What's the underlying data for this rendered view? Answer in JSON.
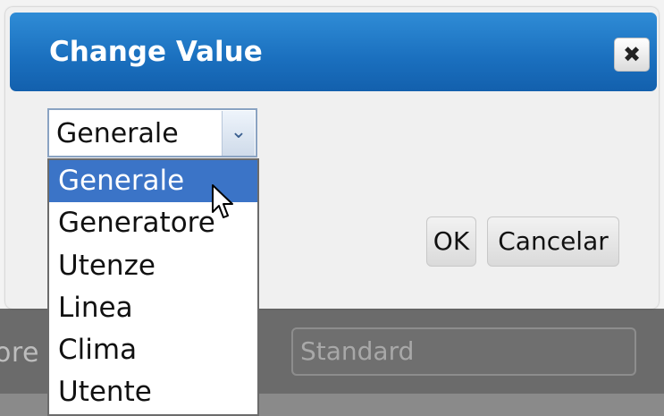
{
  "background": {
    "field_label_partial": "ore",
    "field_value": "Standard"
  },
  "dialog": {
    "title": "Change Value",
    "close_glyph": "✖",
    "select": {
      "value": "Generale",
      "arrow_glyph": "⌄"
    },
    "options": [
      "Generale",
      "Generatore",
      "Utenze",
      "Linea",
      "Clima",
      "Utente"
    ],
    "highlighted_option": "Generale",
    "ok_label": "OK",
    "cancel_label": "Cancelar"
  },
  "colors": {
    "titlebar": "#1a6fbe",
    "selected_option": "#3b74c7"
  },
  "icons": [
    "close-icon",
    "chevron-down-icon",
    "mouse-pointer-icon"
  ]
}
